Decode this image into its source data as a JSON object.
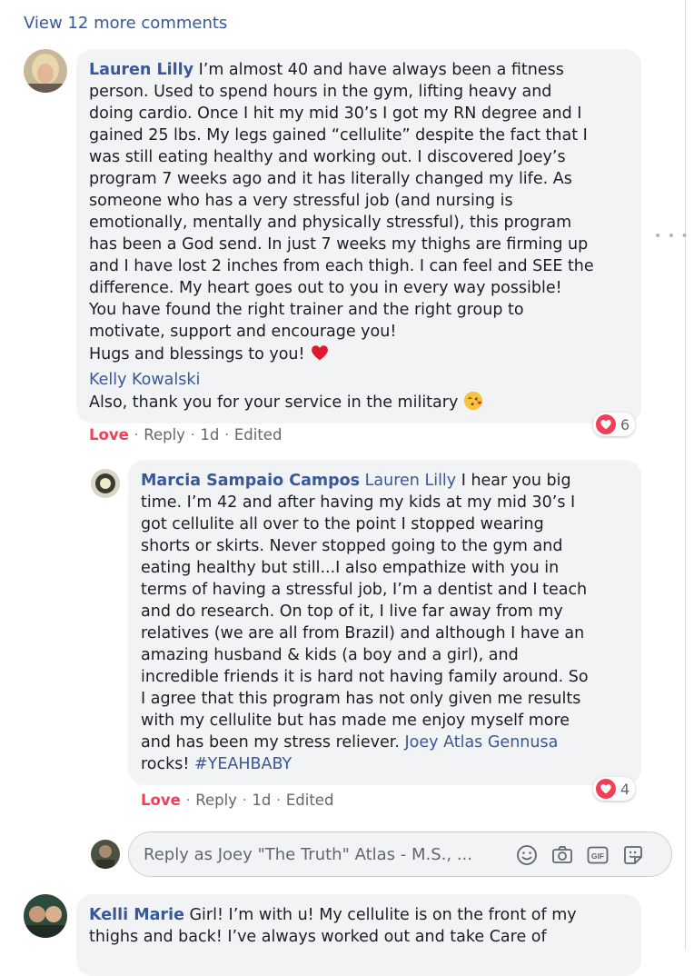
{
  "view_more_label": "View 12 more comments",
  "comment1": {
    "author": "Lauren Lilly",
    "body": " I’m almost 40 and have always been a fitness\nperson. Used to spend hours in the gym, lifting heavy and\ndoing cardio. Once I hit my mid 30’s I got my RN degree and I\ngained 25 lbs. My legs gained “cellulite” despite the fact that I\nwas still eating healthy and working out. I discovered Joey’s\nprogram 7 weeks ago and it has literally changed my life. As\nsomeone who has a very stressful job (and nursing is\nemotionally, mentally and physically stressful), this program\nhas been a God send. In just 7 weeks my thighs are firming up\nand I have lost 2 inches from each thigh. I can feel and SEE the\ndifference. My heart goes out to you in every way possible!\nYou have found the right trainer and the right group to\nmotivate, support and encourage you!\nHugs and blessings to you! ",
    "mention": "Kelly Kowalski",
    "closing": "Also, thank you for your service in the military ",
    "actions": {
      "love": "Love",
      "reply": "Reply",
      "time": "1d",
      "edited": "Edited"
    },
    "reaction_count": "6"
  },
  "comment2": {
    "author": "Marcia Sampaio Campos",
    "mention_lead": "Lauren Lilly",
    "body": " I hear you big\ntime. I’m 42 and after having my kids at my mid 30’s I\ngot cellulite all over to the point I stopped wearing\nshorts or skirts. Never stopped going to the gym and\neating healthy but still...I also empathize with you in\nterms of having a stressful job, I’m a dentist and I teach\nand do research. On top of it, I live far away from my\nrelatives (we are all from Brazil) and although I have an\namazing husband & kids (a boy and a girl), and\nincredible friends it is hard not having family around. So\nI agree that this program has not only given me results\nwith my cellulite but has made me enjoy myself more\nand has been my stress reliever. ",
    "mention_tail": "Joey Atlas Gennusa",
    "after_mention": "\nrocks! ",
    "hashtag": "#YEAHBABY",
    "actions": {
      "love": "Love",
      "reply": "Reply",
      "time": "1d",
      "edited": "Edited"
    },
    "reaction_count": "4"
  },
  "reply_box": {
    "placeholder": "Reply as Joey \"The Truth\" Atlas - M.S., ...",
    "icons": [
      "emoji-icon",
      "camera-icon",
      "gif-icon",
      "sticker-icon"
    ]
  },
  "comment3": {
    "author": "Kelli Marie",
    "body": " Girl! I’m with u! My cellulite is on the front of my\nthighs and back! I’ve always worked out and take Care of"
  },
  "colors": {
    "link": "#385898",
    "love": "#f33e58",
    "bubble": "#f2f3f5",
    "meta": "#606770"
  }
}
